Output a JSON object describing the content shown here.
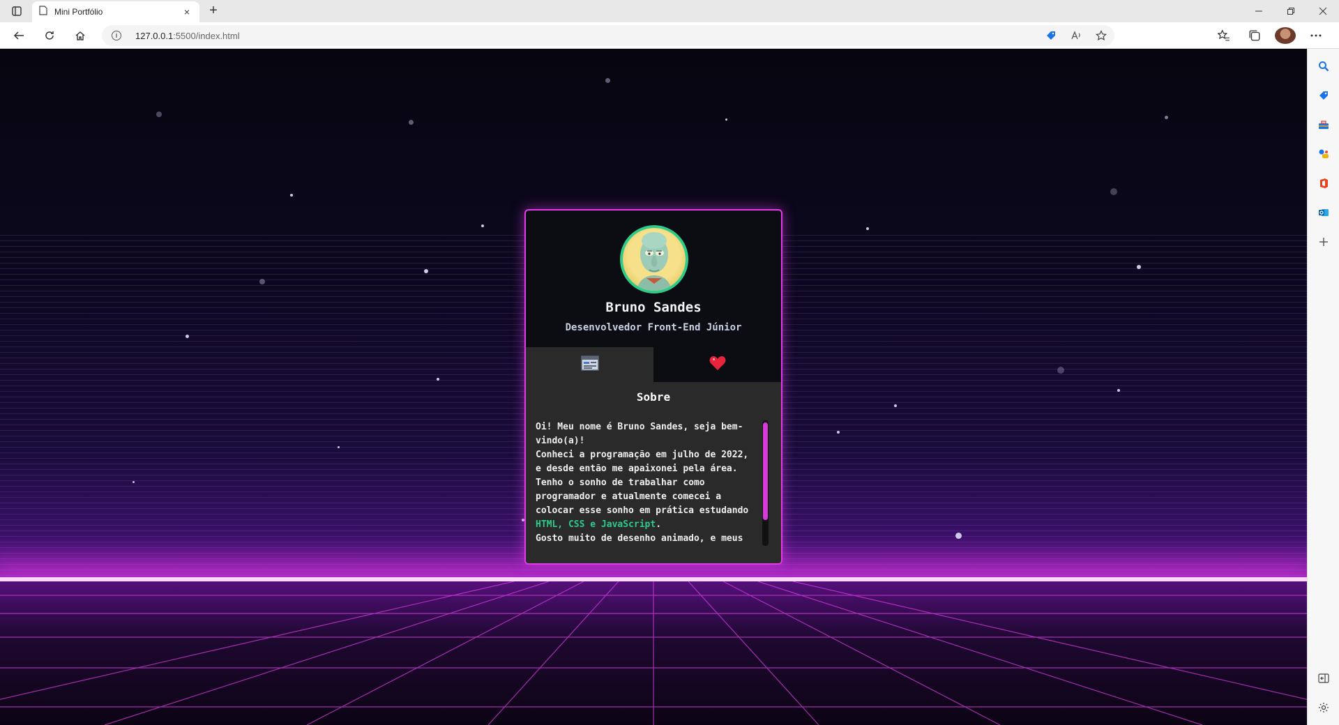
{
  "browser": {
    "tab_title": "Mini Portfólio",
    "url_host": "127.0.0.1",
    "url_rest": ":5500/index.html",
    "new_tab_label": "+",
    "tab_close_label": "×"
  },
  "profile": {
    "name": "Bruno Sandes",
    "role": "Desenvolvedor Front-End Júnior"
  },
  "tabs": [
    {
      "icon": "browser-window-icon",
      "active": true
    },
    {
      "icon": "heart-icon",
      "active": false
    }
  ],
  "about": {
    "title": "Sobre",
    "text_before": "Oi! Meu nome é Bruno Sandes, seja bem-vindo(a)!\nConheci a programação em julho de 2022, e desde então me apaixonei pela área. Tenho o sonho de trabalhar como programador e atualmente comecei a colocar esse sonho em prática estudando ",
    "highlight": "HTML, CSS e JavaScript",
    "text_after": ".\nGosto muito de desenho animado, e meus"
  },
  "colors": {
    "accent": "#e33be8",
    "green": "#2ecc8a",
    "card_bg": "#0b0d12",
    "panel_bg": "#2a2a2a"
  }
}
